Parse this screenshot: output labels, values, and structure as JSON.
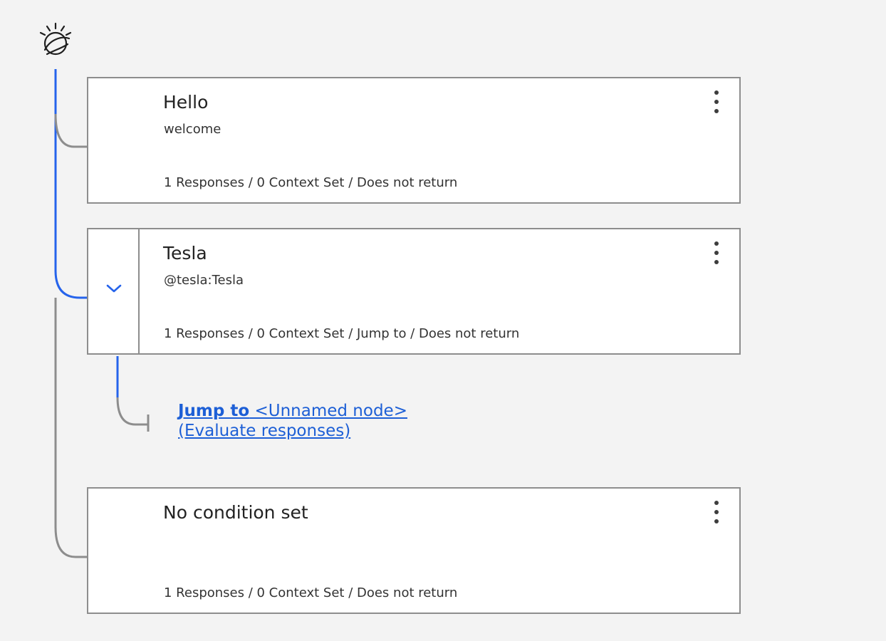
{
  "logo": {
    "icon": "ibm-watson-icon"
  },
  "nodes": [
    {
      "title": "Hello",
      "condition": "welcome",
      "summary": "1 Responses / 0 Context Set / Does not return",
      "menu_icon": "overflow-menu-icon"
    },
    {
      "title": "Tesla",
      "condition": "@tesla:Tesla",
      "summary": "1 Responses / 0 Context Set / Jump to / Does not return",
      "menu_icon": "overflow-menu-icon",
      "expanded": true,
      "expand_icon": "chevron-down-icon"
    },
    {
      "title": "No condition set",
      "condition": "",
      "summary": "1 Responses / 0 Context Set / Does not return",
      "menu_icon": "overflow-menu-icon"
    }
  ],
  "jump": {
    "prefix": "Jump to",
    "target": " <Unnamed node>",
    "mode": "(Evaluate responses)"
  },
  "colors": {
    "accent": "#2563eb",
    "line": "#8d8d8d",
    "link": "#1d5fd6",
    "background": "#f3f3f3"
  }
}
